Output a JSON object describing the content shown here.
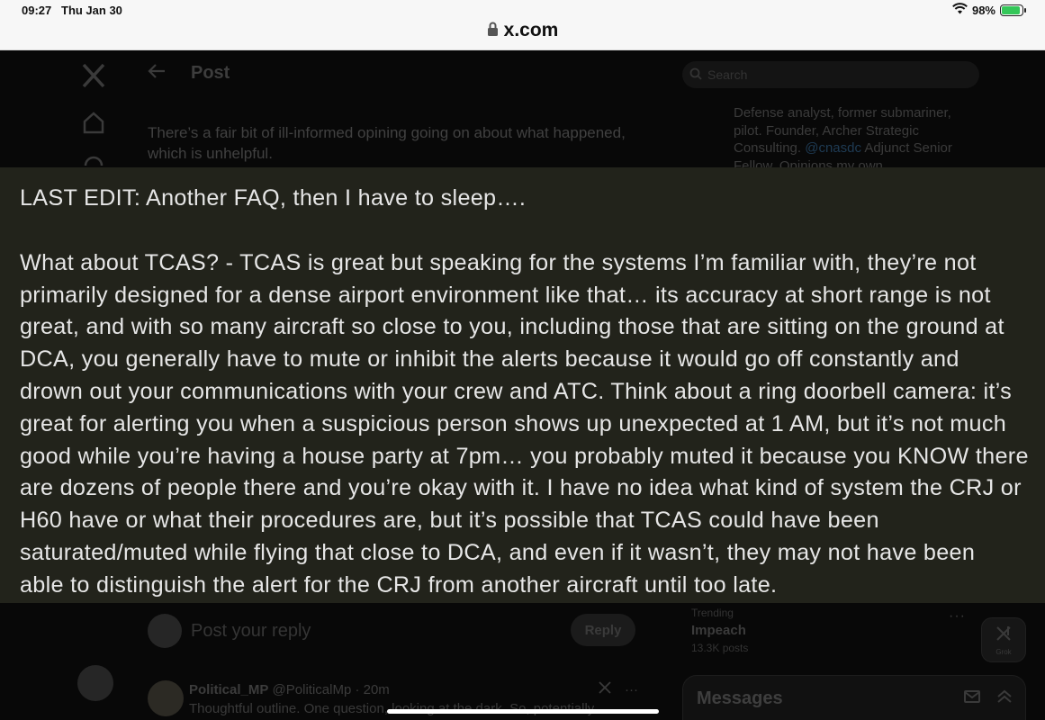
{
  "status_bar": {
    "time": "09:27",
    "date": "Thu Jan 30",
    "battery": "98%",
    "battery_level": 0.98
  },
  "browser": {
    "url": "x.com"
  },
  "header": {
    "title": "Post"
  },
  "post": {
    "partial_text": "There’s a fair bit of ill-informed opining going on about what happened, which is unhelpful."
  },
  "search": {
    "placeholder": "Search"
  },
  "profile": {
    "bio_before": "Defense analyst, former submariner, pilot. Founder, Archer Strategic Consulting.",
    "bio_mention": "@cnasdc",
    "bio_after": "Adjunct Senior Fellow. Opinions my own."
  },
  "overlay": {
    "heading": "LAST EDIT: Another FAQ, then I have to sleep….",
    "lines": [
      "What about TCAS? - TCAS is great but speaking for the systems I’m familiar with, they’re not",
      "primarily designed for a dense airport environment like that… its accuracy at short range is not",
      "great, and with so many aircraft so close to you, including those that are sitting on the ground at",
      "DCA, you generally have to mute or inhibit the alerts because it would go off constantly and",
      "drown out your communications with your crew and ATC. Think about a ring doorbell camera: it’s",
      "great for alerting you when a suspicious person shows up unexpected at 1 AM, but it’s not much",
      "good while you’re having a house party at 7pm… you probably muted it because you KNOW there",
      "are dozens of people there and you’re okay with it. I have no idea what kind of system the CRJ or",
      "H60 have or what their procedures are, but it’s possible that TCAS could have been",
      "saturated/muted while flying that close to DCA, and even if it wasn’t, they may not have been",
      "able to distinguish the alert for the CRJ from another aircraft until too late."
    ]
  },
  "reply": {
    "placeholder": "Post your reply",
    "button": "Reply"
  },
  "trending": {
    "label": "Trending",
    "title": "Impeach",
    "count": "13.3K posts"
  },
  "grok": {
    "label": "Grok"
  },
  "reply_tweet": {
    "name": "Political_MP",
    "handle": "@PoliticalMp · 20m",
    "text": "Thoughtful outline. One question, looking at the dark. So, potentially"
  },
  "messages": {
    "title": "Messages"
  }
}
